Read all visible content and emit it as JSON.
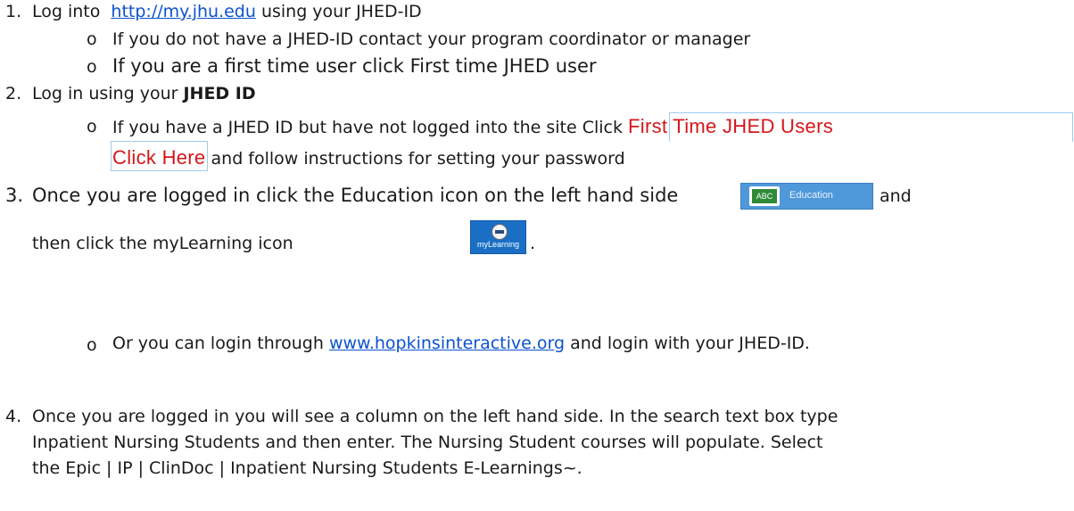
{
  "item1": {
    "number": "1.",
    "prefix": "Log into",
    "link": "http://my.jhu.edu",
    "suffix": " using your JHED-ID",
    "bullets": [
      "If you do not have a JHED-ID contact your program coordinator or manager",
      "If you are a first time user click First time JHED user"
    ]
  },
  "item2": {
    "number": "2.",
    "prefix": "Log in using your ",
    "bold": "JHED ID",
    "bullet": {
      "before": "If you have a JHED ID but have not logged into the site Click ",
      "red_line1": "First Time JHED Users",
      "red_line2": "Click Here",
      "after": " and follow instructions for setting your password"
    }
  },
  "item3": {
    "number": "3.",
    "line1_text": "Once you are logged in click the Education icon on the left hand side",
    "line1_end": "and",
    "line2_text": "then click the myLearning  icon",
    "line2_end": ".",
    "education_icon": {
      "glyph": "ABC",
      "label": "Education",
      "color": "#4f98d9"
    },
    "mylearning_icon": {
      "label": "myLearning",
      "color": "#1a6fc4"
    },
    "bullet": {
      "before": "Or you can login through ",
      "link": "www.hopkinsinteractive.org",
      "after": " and login with your JHED-ID."
    }
  },
  "item4": {
    "number": "4.",
    "lines": [
      "Once you are logged in you will see a column on the left hand side. In the search text box type",
      "Inpatient Nursing Students and then enter. The Nursing Student courses will populate. Select",
      "the Epic | IP | ClinDoc | Inpatient Nursing Students E-Learnings~."
    ]
  },
  "bullet_marker": "o",
  "colors": {
    "link": "#0b52cf",
    "red": "#d4171b",
    "box": "#9ecbf0"
  }
}
